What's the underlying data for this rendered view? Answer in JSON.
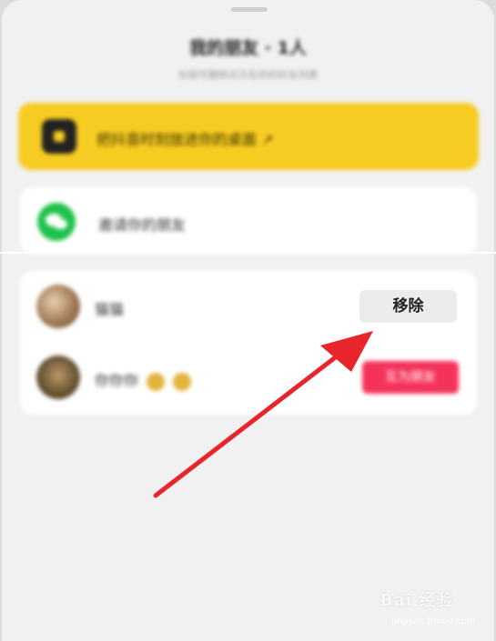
{
  "sheet": {
    "title": "我的朋友 · 1人",
    "subtitle": "长按可删除对方在你的好友列表"
  },
  "banner": {
    "icon": "app-icon",
    "text": "把抖音时刻放进你的桌面 ↗"
  },
  "invite": {
    "icon": "wechat-icon",
    "text": "邀请你的朋友"
  },
  "friends": [
    {
      "name": "猫猫",
      "action_label": "移除"
    },
    {
      "name": "你你你",
      "action_label": "互为朋友"
    }
  ],
  "watermark": {
    "brand": "Bai 经验",
    "url": "jingyan.baidu.com"
  },
  "colors": {
    "banner": "#f7cc22",
    "wechat": "#1fc24a",
    "friend_button": "#f4335a",
    "arrow": "#e8252b"
  }
}
